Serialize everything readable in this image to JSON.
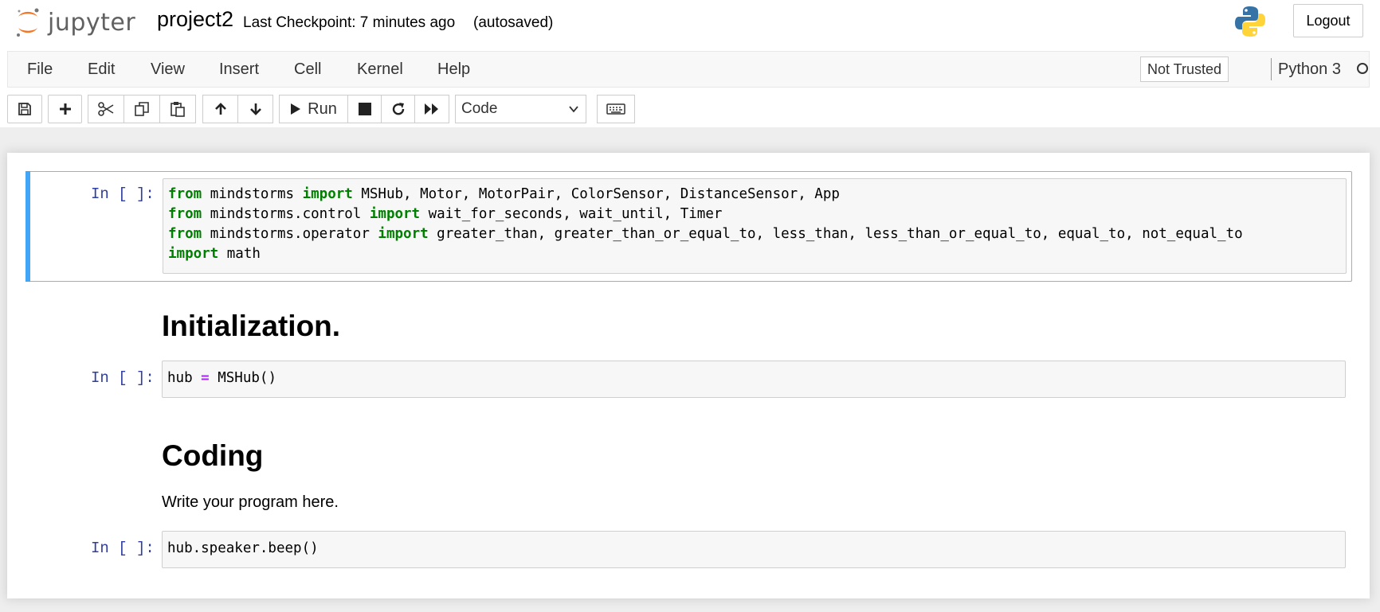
{
  "header": {
    "logo_text": "jupyter",
    "notebook_name": "project2",
    "checkpoint": "Last Checkpoint: 7 minutes ago",
    "autosave_status": "(autosaved)",
    "logout_label": "Logout"
  },
  "menubar": {
    "items": [
      "File",
      "Edit",
      "View",
      "Insert",
      "Cell",
      "Kernel",
      "Help"
    ],
    "trust_label": "Not Trusted",
    "kernel_name": "Python 3"
  },
  "toolbar": {
    "buttons": [
      "save-icon",
      "plus-icon",
      "cut-icon",
      "copy-icon",
      "paste-icon",
      "arrow-up-icon",
      "arrow-down-icon",
      "run-icon",
      "stop-icon",
      "restart-icon",
      "fast-forward-icon",
      "keyboard-icon"
    ],
    "run_label": "Run",
    "cell_type": "Code"
  },
  "cells": {
    "c1": {
      "prompt": "In [ ]:",
      "lines": [
        [
          {
            "t": "from",
            "k": "kw"
          },
          {
            "t": " mindstorms "
          },
          {
            "t": "import",
            "k": "kw"
          },
          {
            "t": " MSHub, Motor, MotorPair, ColorSensor, DistanceSensor, App"
          }
        ],
        [
          {
            "t": "from",
            "k": "kw"
          },
          {
            "t": " mindstorms.control "
          },
          {
            "t": "import",
            "k": "kw"
          },
          {
            "t": " wait_for_seconds, wait_until, Timer"
          }
        ],
        [
          {
            "t": "from",
            "k": "kw"
          },
          {
            "t": " mindstorms.operator "
          },
          {
            "t": "import",
            "k": "kw"
          },
          {
            "t": " greater_than, greater_than_or_equal_to, less_than, less_than_or_equal_to, equal_to, not_equal_to"
          }
        ],
        [
          {
            "t": "import",
            "k": "kw"
          },
          {
            "t": " math"
          }
        ]
      ]
    },
    "md1": {
      "heading": "Initialization."
    },
    "c2": {
      "prompt": "In [ ]:",
      "lines": [
        [
          {
            "t": "hub "
          },
          {
            "t": "=",
            "k": "op"
          },
          {
            "t": " MSHub()"
          }
        ]
      ]
    },
    "md2": {
      "heading": "Coding",
      "text": "Write your program here."
    },
    "c3": {
      "prompt": "In [ ]:",
      "lines": [
        [
          {
            "t": "hub.speaker.beep()"
          }
        ]
      ]
    }
  },
  "colors": {
    "selected_bar": "#42a5f5",
    "prompt": "#303f9f",
    "keyword": "#008000",
    "operator": "#aa22ff",
    "logo_orange": "#f37626"
  }
}
